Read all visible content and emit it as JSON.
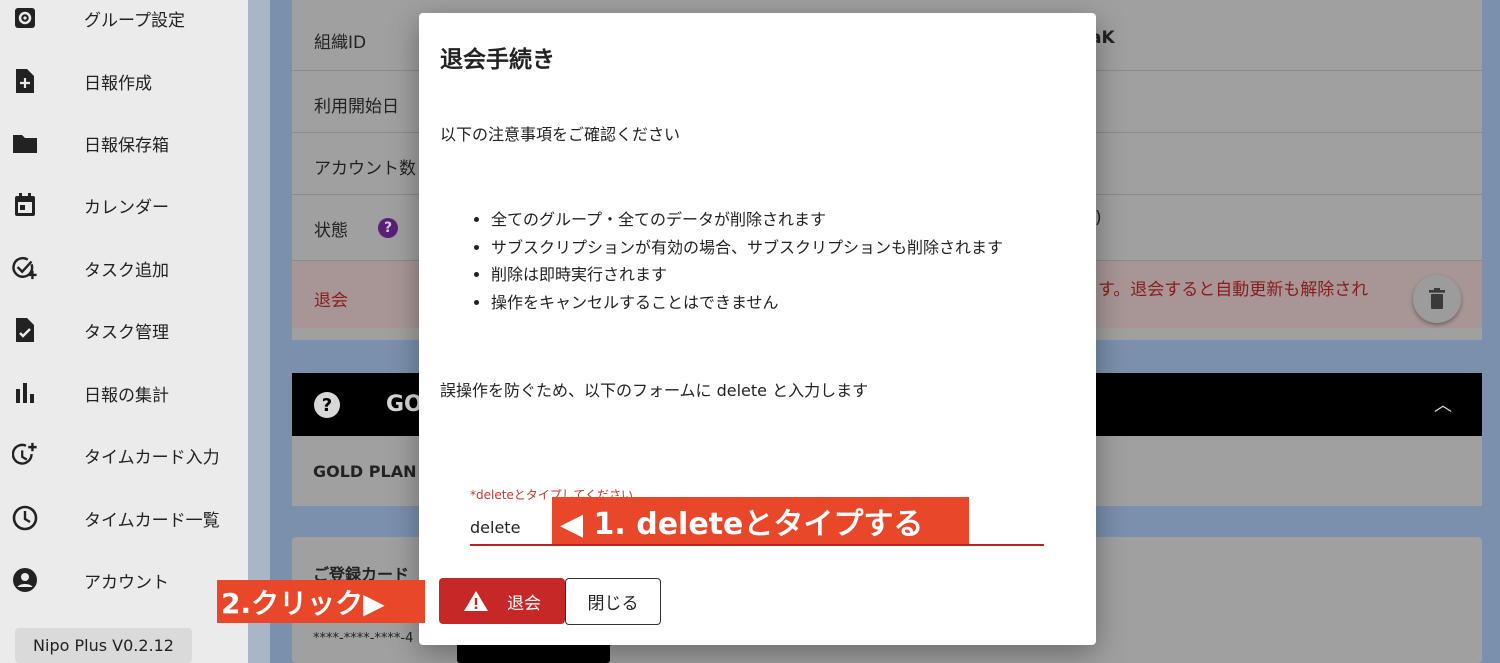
{
  "sidebar": {
    "items": [
      {
        "label": "グループ設定",
        "icon": "gear-icon"
      },
      {
        "label": "日報作成",
        "icon": "note-add-icon"
      },
      {
        "label": "日報保存箱",
        "icon": "folder-icon"
      },
      {
        "label": "カレンダー",
        "icon": "calendar-icon"
      },
      {
        "label": "タスク追加",
        "icon": "task-add-icon"
      },
      {
        "label": "タスク管理",
        "icon": "task-check-icon"
      },
      {
        "label": "日報の集計",
        "icon": "bar-chart-icon"
      },
      {
        "label": "タイムカード入力",
        "icon": "time-add-icon"
      },
      {
        "label": "タイムカード一覧",
        "icon": "clock-icon"
      },
      {
        "label": "アカウント",
        "icon": "account-icon"
      }
    ],
    "version": "Nipo Plus V0.2.12"
  },
  "background": {
    "rows": [
      {
        "label": "組織ID",
        "value": "aK"
      },
      {
        "label": "利用開始日",
        "value": ""
      },
      {
        "label": "アカウント数",
        "value": ""
      },
      {
        "label": "状態",
        "value": ")"
      }
    ],
    "withdraw_label": "退会",
    "withdraw_note": "す。退会すると自動更新も解除され",
    "section_header": "GO",
    "plan_text": "GOLD PLAN",
    "card_title": "ご登録カード",
    "card_number": "****-****-****-4"
  },
  "dialog": {
    "title": "退会手続き",
    "intro": "以下の注意事項をご確認ください",
    "bullets": [
      "全てのグループ・全てのデータが削除されます",
      "サブスクリプションが有効の場合、サブスクリプションも削除されます",
      "削除は即時実行されます",
      "操作をキャンセルすることはできません"
    ],
    "instruction": "誤操作を防ぐため、以下のフォームに delete と入力します",
    "field_label": "*deleteとタイプしてください",
    "field_value": "delete",
    "delete_button": "退会",
    "close_button": "閉じる"
  },
  "annotations": {
    "step1": "◀ 1.  deleteとタイプする",
    "step2": "2.クリック▶"
  },
  "colors": {
    "danger": "#c62828",
    "annotation": "#e8472a",
    "help_badge": "#7b2fa8"
  }
}
